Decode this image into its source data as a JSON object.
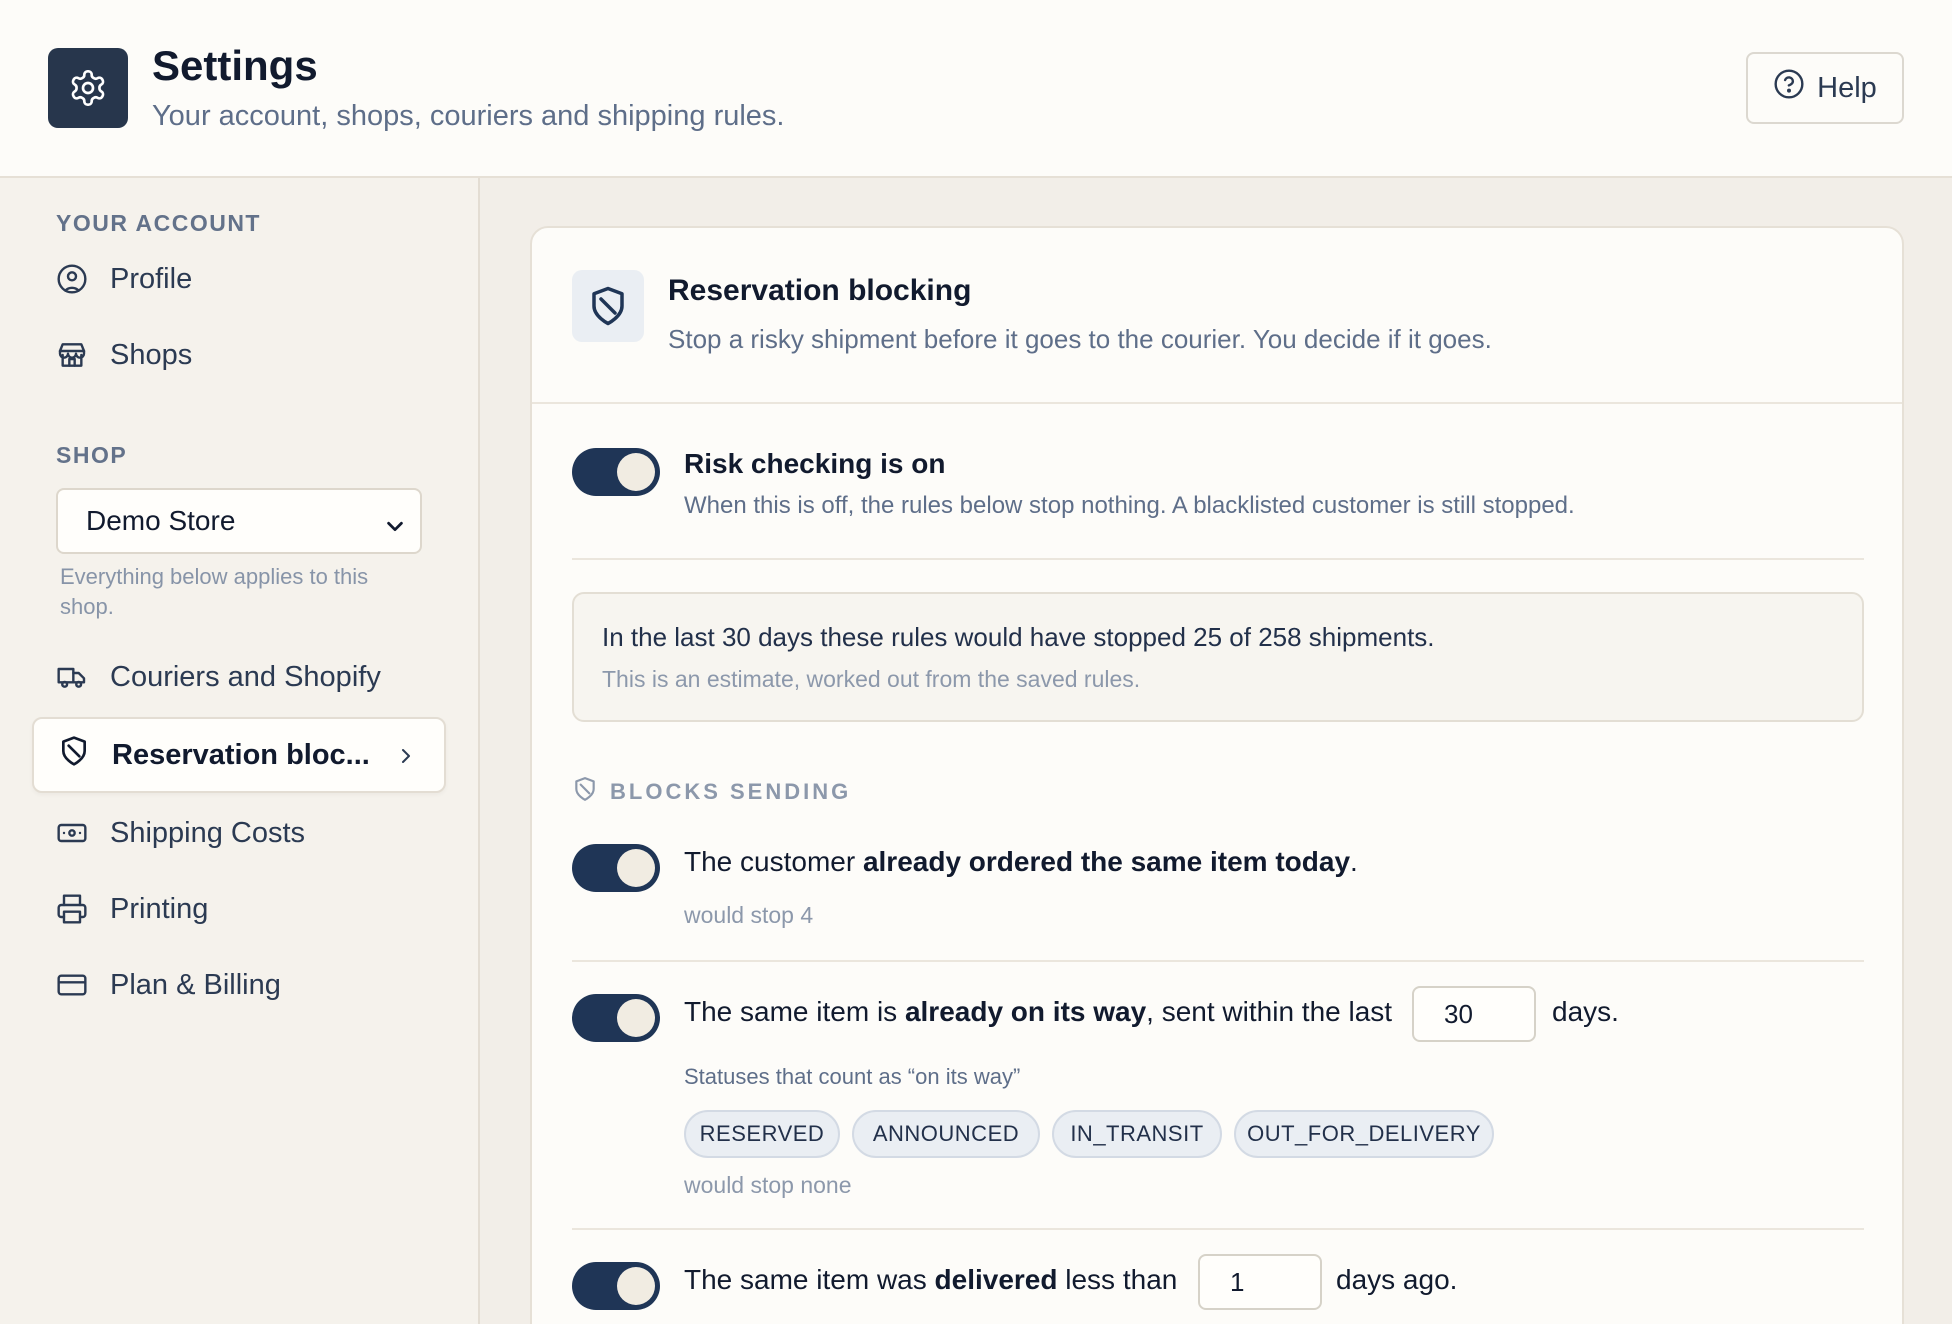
{
  "header": {
    "title": "Settings",
    "subtitle": "Your account, shops, couriers and shipping rules.",
    "help_label": "Help",
    "icons": {
      "app": "gear-icon",
      "help": "help-circle-icon"
    }
  },
  "sidebar": {
    "account_section": "YOUR ACCOUNT",
    "account_items": [
      {
        "label": "Profile",
        "icon": "user-circle-icon"
      },
      {
        "label": "Shops",
        "icon": "store-icon"
      }
    ],
    "shop_section": "SHOP",
    "shop_select": {
      "value": "Demo Store",
      "hint": "Everything below applies to this shop."
    },
    "shop_items": [
      {
        "label": "Couriers and Shopify",
        "icon": "truck-icon"
      },
      {
        "label": "Reservation bloc...",
        "icon": "shield-icon",
        "active": true
      },
      {
        "label": "Shipping Costs",
        "icon": "banknote-icon"
      },
      {
        "label": "Printing",
        "icon": "printer-icon"
      },
      {
        "label": "Plan & Billing",
        "icon": "credit-card-icon"
      }
    ]
  },
  "card": {
    "title": "Reservation blocking",
    "description": "Stop a risky shipment before it goes to the courier. You decide if it goes.",
    "master_toggle": {
      "on": true,
      "title": "Risk checking is on",
      "subtitle": "When this is off, the rules below stop nothing. A blacklisted customer is still stopped."
    },
    "estimate": {
      "main": "In the last 30 days these rules would have stopped 25 of 258 shipments.",
      "note": "This is an estimate, worked out from the saved rules."
    },
    "blocks_label": "BLOCKS SENDING",
    "rules": [
      {
        "on": true,
        "text_before": "The customer ",
        "text_bold": "already ordered the same item today",
        "text_after": ".",
        "result": "would stop 4"
      },
      {
        "on": true,
        "text_before": "The same item is ",
        "text_bold": "already on its way",
        "text_after": ", sent within the last",
        "input_value": "30",
        "suffix": "days.",
        "statuses_label": "Statuses that count as “on its way”",
        "statuses": [
          "RESERVED",
          "ANNOUNCED",
          "IN_TRANSIT",
          "OUT_FOR_DELIVERY"
        ],
        "result": "would stop none"
      },
      {
        "on": true,
        "text_before": "The same item was ",
        "text_bold": "delivered",
        "text_after": " less than",
        "input_value": "1",
        "suffix": "days ago."
      }
    ]
  },
  "colors": {
    "accent": "#1f3556",
    "app_icon_bg": "#27364c",
    "page_bg": "#f2eee8",
    "surface": "#fdfcf9",
    "muted_text": "#5e6e89"
  }
}
